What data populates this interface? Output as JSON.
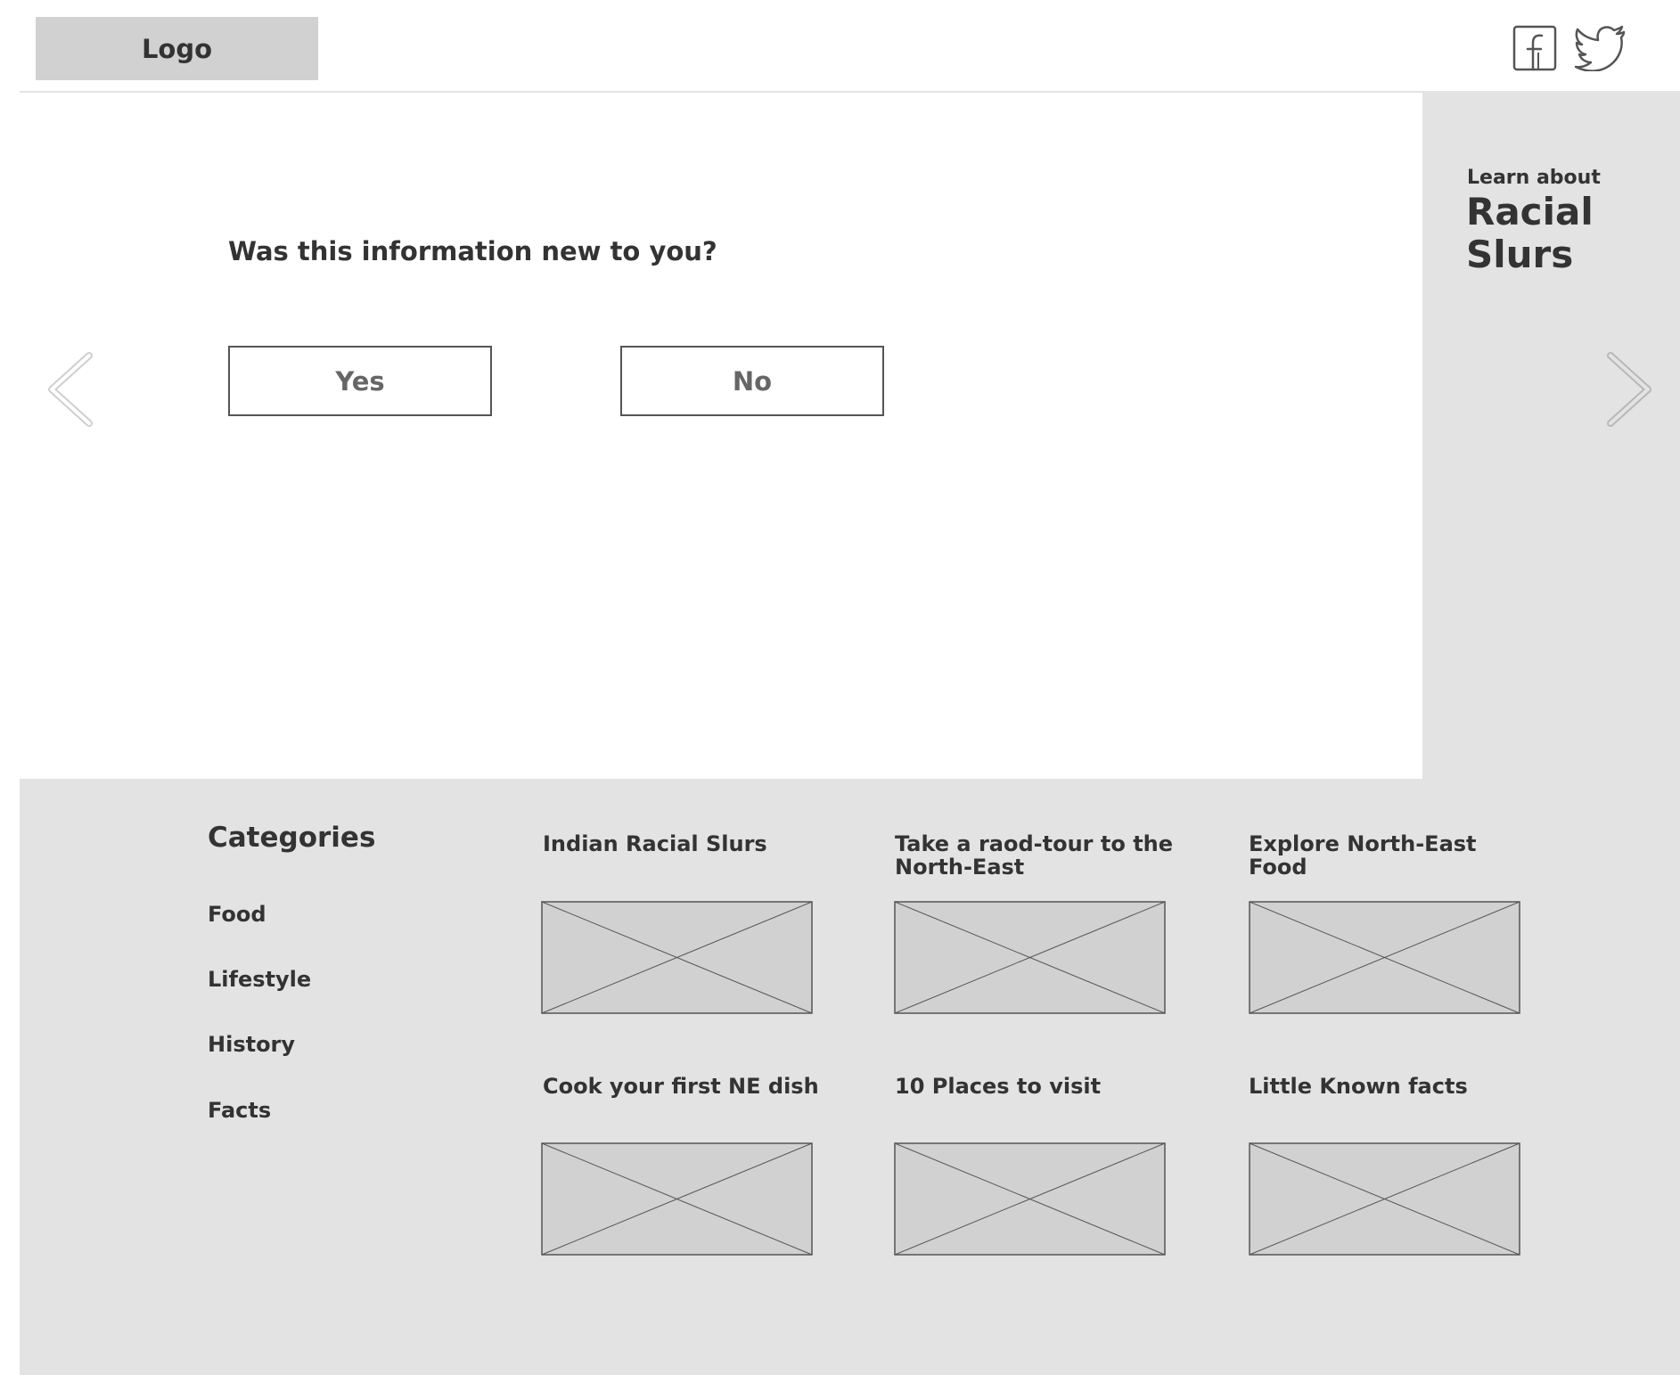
{
  "header": {
    "logo_label": "Logo",
    "social_icons": [
      "facebook-icon",
      "twitter-icon"
    ]
  },
  "feature": {
    "eyebrow": "Learn about",
    "title": "Racial Slurs"
  },
  "poll": {
    "question": "Was this information new to you?",
    "yes_label": "Yes",
    "no_label": "No"
  },
  "navigation": {
    "prev_icon": "chevron-left-icon",
    "next_icon": "chevron-right-icon"
  },
  "footer": {
    "categories_title": "Categories",
    "categories": [
      "Food",
      "Lifestyle",
      "History",
      "Facts"
    ],
    "cards": [
      {
        "title": "Indian Racial Slurs"
      },
      {
        "title": "Take  a raod-tour to the North-East"
      },
      {
        "title": "Explore North-East Food"
      },
      {
        "title": "Cook your first NE dish"
      },
      {
        "title": "10 Places to visit"
      },
      {
        "title": "Little Known facts"
      }
    ]
  },
  "colors": {
    "text": "#333333",
    "button_text": "#666666",
    "panel_bg": "#e3e3e3",
    "logo_bg": "#d1d1d1",
    "placeholder_bg": "#d1d1d1"
  }
}
